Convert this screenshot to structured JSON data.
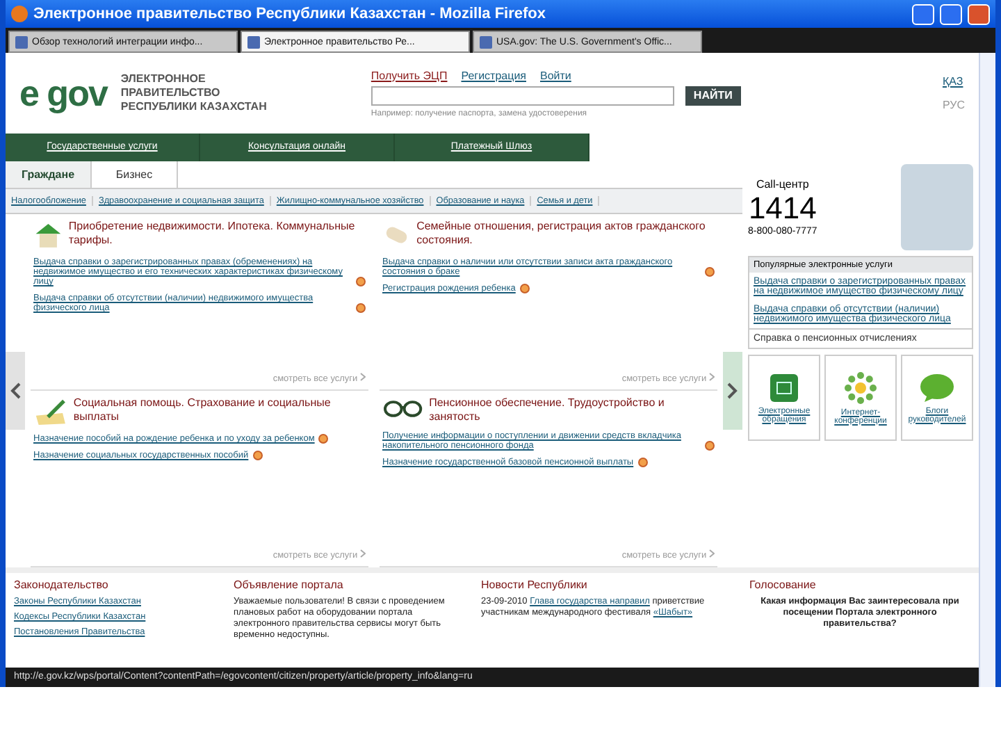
{
  "window": {
    "title": "Электронное правительство Республики Казахстан - Mozilla Firefox"
  },
  "browser_tabs": [
    {
      "label": "Обзор технологий интеграции инфо...",
      "selected": false
    },
    {
      "label": "Электронное правительство Ре...",
      "selected": true
    },
    {
      "label": "USA.gov: The U.S. Government's Offic...",
      "selected": false
    }
  ],
  "header": {
    "logo": "e gov",
    "org_line_1": "ЭЛЕКТРОННОЕ ПРАВИТЕЛЬСТВО",
    "org_line_2": "РЕСПУБЛИКИ КАЗАХСТАН",
    "links": [
      "Получить ЭЦП",
      "Регистрация",
      "Войти"
    ],
    "search": {
      "button": "НАЙТИ",
      "hint": "Например: получение паспорта, замена удостоверения"
    },
    "languages": [
      {
        "label": "ҚАЗ",
        "selected": false
      },
      {
        "label": "РУС",
        "selected": true
      }
    ]
  },
  "main_nav": [
    "Государственные услуги",
    "Консультация онлайн",
    "Платежный Шлюз"
  ],
  "audience_tabs": [
    {
      "label": "Граждане",
      "selected": true
    },
    {
      "label": "Бизнес",
      "selected": false
    }
  ],
  "sub_nav": [
    "Налогообложение",
    "Здравоохранение и социальная защита",
    "Жилищно-коммунальное хозяйство",
    "Образование и наука",
    "Семья и дети"
  ],
  "cards": [
    {
      "title": "Приобретение недвижимости. Ипотека. Коммунальные тарифы.",
      "links": [
        "Выдача справки о зарегистрированных правах (обременениях) на недвижимое имущество и его технических характеристиках физическому лицу",
        "Выдача справки об отсутствии (наличии) недвижимого имущества физического лица"
      ],
      "more": "смотреть все услуги"
    },
    {
      "title": "Семейные отношения, регистрация актов гражданского состояния.",
      "links": [
        "Выдача справки о наличии или отсутствии записи акта гражданского состояния о браке",
        "Регистрация рождения ребенка"
      ],
      "more": "смотреть все услуги"
    },
    {
      "title": "Социальная помощь. Страхование и социальные выплаты",
      "links": [
        "Назначение пособий на рождение ребенка и по уходу за ребенком",
        "Назначение социальных государственных пособий"
      ],
      "more": "смотреть все услуги"
    },
    {
      "title": "Пенсионное обеспечение. Трудоустройство и занятость",
      "links": [
        "Получение информации о поступлении и движении средств вкладчика накопительного пенсионного фонда",
        "Назначение государственной базовой пенсионной выплаты"
      ],
      "more": "смотреть все услуги"
    }
  ],
  "call_center": {
    "label": "Call-центр",
    "number": "1414",
    "phone": "8-800-080-7777"
  },
  "popular": {
    "title": "Популярные электронные услуги",
    "links": [
      "Выдача справки о зарегистрированных правах на недвижимое имущество физическому лицу",
      "Выдача справки об отсутствии (наличии) недвижимого имущества физического лица"
    ],
    "note": "Справка о пенсионных отчислениях"
  },
  "quick_links": [
    {
      "label": "Электронные обращения"
    },
    {
      "label": "Интернет-конференции"
    },
    {
      "label": "Блоги руководителей"
    }
  ],
  "footer": {
    "law": {
      "title": "Законодательство",
      "links": [
        "Законы Республики Казахстан",
        "Кодексы Республики Казахстан",
        "Постановления Правительства"
      ]
    },
    "notice": {
      "title": "Объявление портала",
      "text": "Уважаемые пользователи! В связи с проведением плановых работ на оборудовании портала электронного правительства сервисы могут быть временно недоступны."
    },
    "news": {
      "title": "Новости Республики",
      "date": "23-09-2010",
      "link": "Глава государства направил",
      "text": "приветствие участникам международного фестиваля",
      "tail": "«Шабыт»"
    },
    "poll": {
      "title": "Голосование",
      "question": "Какая информация Вас заинтересовала при посещении Портала электронного правительства?"
    }
  },
  "status_bar": {
    "url": "http://e.gov.kz/wps/portal/Content?contentPath=/egovcontent/citizen/property/article/property_info&lang=ru"
  }
}
